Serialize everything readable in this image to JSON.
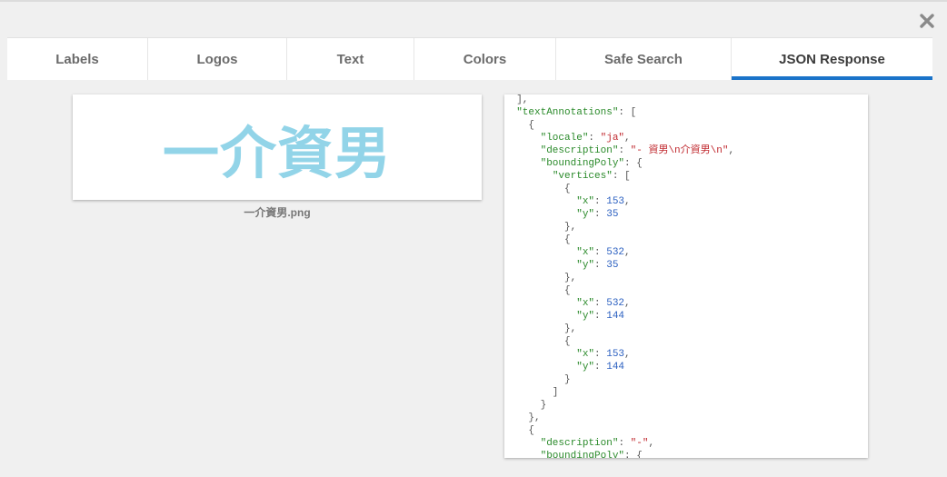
{
  "dialog": {
    "close_icon": "close-icon"
  },
  "tabs": [
    {
      "label": "Labels",
      "active": false
    },
    {
      "label": "Logos",
      "active": false
    },
    {
      "label": "Text",
      "active": false
    },
    {
      "label": "Colors",
      "active": false
    },
    {
      "label": "Safe Search",
      "active": false
    },
    {
      "label": "JSON Response",
      "active": true
    }
  ],
  "image_preview": {
    "text": "一介資男",
    "filename": "一介資男.png",
    "text_color": "#92d4e8"
  },
  "json_response": {
    "lines": [
      [
        {
          "t": "p",
          "v": "  ],"
        }
      ],
      [
        {
          "t": "p",
          "v": "  "
        },
        {
          "t": "k",
          "v": "\"textAnnotations\""
        },
        {
          "t": "p",
          "v": ": ["
        }
      ],
      [
        {
          "t": "p",
          "v": "    {"
        }
      ],
      [
        {
          "t": "p",
          "v": "      "
        },
        {
          "t": "k",
          "v": "\"locale\""
        },
        {
          "t": "p",
          "v": ": "
        },
        {
          "t": "s",
          "v": "\"ja\""
        },
        {
          "t": "p",
          "v": ","
        }
      ],
      [
        {
          "t": "p",
          "v": "      "
        },
        {
          "t": "k",
          "v": "\"description\""
        },
        {
          "t": "p",
          "v": ": "
        },
        {
          "t": "s",
          "v": "\"- 資男\\n介資男\\n\""
        },
        {
          "t": "p",
          "v": ","
        }
      ],
      [
        {
          "t": "p",
          "v": "      "
        },
        {
          "t": "k",
          "v": "\"boundingPoly\""
        },
        {
          "t": "p",
          "v": ": {"
        }
      ],
      [
        {
          "t": "p",
          "v": "        "
        },
        {
          "t": "k",
          "v": "\"vertices\""
        },
        {
          "t": "p",
          "v": ": ["
        }
      ],
      [
        {
          "t": "p",
          "v": "          {"
        }
      ],
      [
        {
          "t": "p",
          "v": "            "
        },
        {
          "t": "k",
          "v": "\"x\""
        },
        {
          "t": "p",
          "v": ": "
        },
        {
          "t": "n",
          "v": "153"
        },
        {
          "t": "p",
          "v": ","
        }
      ],
      [
        {
          "t": "p",
          "v": "            "
        },
        {
          "t": "k",
          "v": "\"y\""
        },
        {
          "t": "p",
          "v": ": "
        },
        {
          "t": "n",
          "v": "35"
        }
      ],
      [
        {
          "t": "p",
          "v": "          },"
        }
      ],
      [
        {
          "t": "p",
          "v": "          {"
        }
      ],
      [
        {
          "t": "p",
          "v": "            "
        },
        {
          "t": "k",
          "v": "\"x\""
        },
        {
          "t": "p",
          "v": ": "
        },
        {
          "t": "n",
          "v": "532"
        },
        {
          "t": "p",
          "v": ","
        }
      ],
      [
        {
          "t": "p",
          "v": "            "
        },
        {
          "t": "k",
          "v": "\"y\""
        },
        {
          "t": "p",
          "v": ": "
        },
        {
          "t": "n",
          "v": "35"
        }
      ],
      [
        {
          "t": "p",
          "v": "          },"
        }
      ],
      [
        {
          "t": "p",
          "v": "          {"
        }
      ],
      [
        {
          "t": "p",
          "v": "            "
        },
        {
          "t": "k",
          "v": "\"x\""
        },
        {
          "t": "p",
          "v": ": "
        },
        {
          "t": "n",
          "v": "532"
        },
        {
          "t": "p",
          "v": ","
        }
      ],
      [
        {
          "t": "p",
          "v": "            "
        },
        {
          "t": "k",
          "v": "\"y\""
        },
        {
          "t": "p",
          "v": ": "
        },
        {
          "t": "n",
          "v": "144"
        }
      ],
      [
        {
          "t": "p",
          "v": "          },"
        }
      ],
      [
        {
          "t": "p",
          "v": "          {"
        }
      ],
      [
        {
          "t": "p",
          "v": "            "
        },
        {
          "t": "k",
          "v": "\"x\""
        },
        {
          "t": "p",
          "v": ": "
        },
        {
          "t": "n",
          "v": "153"
        },
        {
          "t": "p",
          "v": ","
        }
      ],
      [
        {
          "t": "p",
          "v": "            "
        },
        {
          "t": "k",
          "v": "\"y\""
        },
        {
          "t": "p",
          "v": ": "
        },
        {
          "t": "n",
          "v": "144"
        }
      ],
      [
        {
          "t": "p",
          "v": "          }"
        }
      ],
      [
        {
          "t": "p",
          "v": "        ]"
        }
      ],
      [
        {
          "t": "p",
          "v": "      }"
        }
      ],
      [
        {
          "t": "p",
          "v": "    },"
        }
      ],
      [
        {
          "t": "p",
          "v": "    {"
        }
      ],
      [
        {
          "t": "p",
          "v": "      "
        },
        {
          "t": "k",
          "v": "\"description\""
        },
        {
          "t": "p",
          "v": ": "
        },
        {
          "t": "s",
          "v": "\"-\""
        },
        {
          "t": "p",
          "v": ","
        }
      ],
      [
        {
          "t": "p",
          "v": "      "
        },
        {
          "t": "k",
          "v": "\"boundingPoly\""
        },
        {
          "t": "p",
          "v": ": {"
        }
      ]
    ]
  }
}
